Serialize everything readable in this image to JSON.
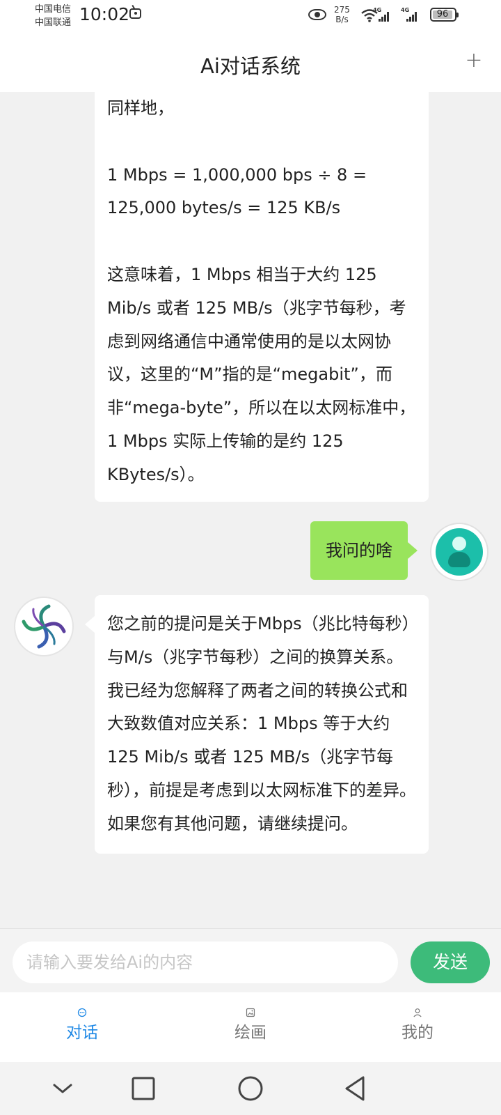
{
  "status_bar": {
    "carrier_1": "中国电信",
    "carrier_2": "中国联通",
    "time": "10:02",
    "net_speed_value": "275",
    "net_speed_unit": "B/s",
    "signal_1_tag": "4G",
    "signal_2_tag": "4G",
    "battery": "96"
  },
  "header": {
    "title": "Ai对话系统",
    "add_label": "+"
  },
  "messages": [
    {
      "role": "ai",
      "paragraphs": [
        "同样地，",
        "",
        "1 Mbps = 1,000,000 bps ÷ 8 = 125,000 bytes/s = 125 KB/s",
        "",
        "这意味着，1 Mbps 相当于大约 125 Mib/s 或者 125 MB/s（兆字节每秒，考虑到网络通信中通常使用的是以太网协议，这里的“M”指的是“megabit”，而非“mega-byte”，所以在以太网标准中，1 Mbps 实际上传输的是约 125 KBytes/s）。"
      ]
    },
    {
      "role": "user",
      "text": "我问的啥"
    },
    {
      "role": "ai",
      "paragraphs": [
        "您之前的提问是关于Mbps（兆比特每秒）与M/s（兆字节每秒）之间的换算关系。我已经为您解释了两者之间的转换公式和大致数值对应关系：1 Mbps 等于大约 125 Mib/s 或者 125 MB/s（兆字节每秒），前提是考虑到以太网标准下的差异。如果您有其他问题，请继续提问。"
      ]
    }
  ],
  "input": {
    "placeholder": "请输入要发给Ai的内容",
    "value": "",
    "send_label": "发送"
  },
  "tabs": [
    {
      "label": "对话",
      "icon": "chat-icon",
      "active": true
    },
    {
      "label": "绘画",
      "icon": "image-icon",
      "active": false
    },
    {
      "label": "我的",
      "icon": "user-icon",
      "active": false
    }
  ],
  "colors": {
    "user_bubble": "#99e45c",
    "send_button": "#3dbb7a",
    "active_tab": "#1e88e5",
    "user_avatar": "#1cbfaa"
  }
}
